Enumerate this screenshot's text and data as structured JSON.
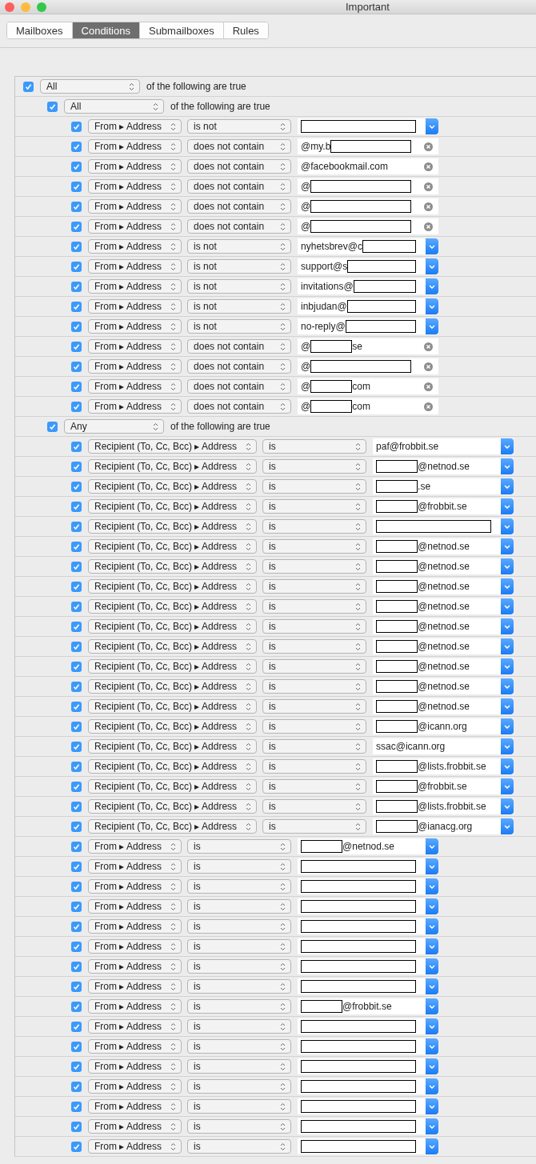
{
  "window": {
    "title": "Important"
  },
  "tabs": [
    {
      "label": "Mailboxes",
      "selected": false
    },
    {
      "label": "Conditions",
      "selected": true
    },
    {
      "label": "Submailboxes",
      "selected": false
    },
    {
      "label": "Rules",
      "selected": false
    }
  ],
  "conditions": {
    "kind": "group",
    "checked": true,
    "match": "All",
    "text": "of the following are true",
    "children": [
      {
        "kind": "group",
        "checked": true,
        "match": "All",
        "text": "of the following are true",
        "children": [
          {
            "kind": "rule",
            "checked": true,
            "field": "From ▸ Address",
            "operator": "is not",
            "value": {
              "kind": "menu",
              "redacted": true
            }
          },
          {
            "kind": "rule",
            "checked": true,
            "field": "From ▸ Address",
            "operator": "does not contain",
            "value": {
              "kind": "clear",
              "before": "@my.b",
              "redacted": true
            }
          },
          {
            "kind": "rule",
            "checked": true,
            "field": "From ▸ Address",
            "operator": "does not contain",
            "value": {
              "kind": "clear",
              "before": "@facebookmail.com"
            }
          },
          {
            "kind": "rule",
            "checked": true,
            "field": "From ▸ Address",
            "operator": "does not contain",
            "value": {
              "kind": "clear",
              "before": "@",
              "redacted": true
            }
          },
          {
            "kind": "rule",
            "checked": true,
            "field": "From ▸ Address",
            "operator": "does not contain",
            "value": {
              "kind": "clear",
              "before": "@",
              "redacted": true
            }
          },
          {
            "kind": "rule",
            "checked": true,
            "field": "From ▸ Address",
            "operator": "does not contain",
            "value": {
              "kind": "clear",
              "before": "@",
              "redacted": true
            }
          },
          {
            "kind": "rule",
            "checked": true,
            "field": "From ▸ Address",
            "operator": "is not",
            "value": {
              "kind": "menu",
              "before": "nyhetsbrev@c",
              "redacted": true
            }
          },
          {
            "kind": "rule",
            "checked": true,
            "field": "From ▸ Address",
            "operator": "is not",
            "value": {
              "kind": "menu",
              "before": "support@s",
              "redacted": true
            }
          },
          {
            "kind": "rule",
            "checked": true,
            "field": "From ▸ Address",
            "operator": "is not",
            "value": {
              "kind": "menu",
              "before": "invitations@",
              "redacted": true
            }
          },
          {
            "kind": "rule",
            "checked": true,
            "field": "From ▸ Address",
            "operator": "is not",
            "value": {
              "kind": "menu",
              "before": "inbjudan@",
              "redacted": true
            }
          },
          {
            "kind": "rule",
            "checked": true,
            "field": "From ▸ Address",
            "operator": "is not",
            "value": {
              "kind": "menu",
              "before": "no-reply@",
              "redacted": true
            }
          },
          {
            "kind": "rule",
            "checked": true,
            "field": "From ▸ Address",
            "operator": "does not contain",
            "value": {
              "kind": "clear",
              "before": "@",
              "redacted": true,
              "after": "se"
            }
          },
          {
            "kind": "rule",
            "checked": true,
            "field": "From ▸ Address",
            "operator": "does not contain",
            "value": {
              "kind": "clear",
              "before": "@",
              "redacted": true
            }
          },
          {
            "kind": "rule",
            "checked": true,
            "field": "From ▸ Address",
            "operator": "does not contain",
            "value": {
              "kind": "clear",
              "before": "@",
              "redacted": true,
              "after": "com"
            }
          },
          {
            "kind": "rule",
            "checked": true,
            "field": "From ▸ Address",
            "operator": "does not contain",
            "value": {
              "kind": "clear",
              "before": "@",
              "redacted": true,
              "after": "com"
            }
          }
        ]
      },
      {
        "kind": "group",
        "checked": true,
        "match": "Any",
        "text": "of the following are true",
        "children": [
          {
            "kind": "rule",
            "checked": true,
            "field": "Recipient (To, Cc, Bcc) ▸ Address",
            "operator": "is",
            "value": {
              "kind": "menu",
              "before": "paf@frobbit.se"
            }
          },
          {
            "kind": "rule",
            "checked": true,
            "field": "Recipient (To, Cc, Bcc) ▸ Address",
            "operator": "is",
            "value": {
              "kind": "menu",
              "redacted": true,
              "after": "@netnod.se"
            }
          },
          {
            "kind": "rule",
            "checked": true,
            "field": "Recipient (To, Cc, Bcc) ▸ Address",
            "operator": "is",
            "value": {
              "kind": "menu",
              "redacted": true,
              "after": ".se"
            }
          },
          {
            "kind": "rule",
            "checked": true,
            "field": "Recipient (To, Cc, Bcc) ▸ Address",
            "operator": "is",
            "value": {
              "kind": "menu",
              "redacted": true,
              "after": "@frobbit.se"
            }
          },
          {
            "kind": "rule",
            "checked": true,
            "field": "Recipient (To, Cc, Bcc) ▸ Address",
            "operator": "is",
            "value": {
              "kind": "menu",
              "redacted": true
            }
          },
          {
            "kind": "rule",
            "checked": true,
            "field": "Recipient (To, Cc, Bcc) ▸ Address",
            "operator": "is",
            "value": {
              "kind": "menu",
              "redacted": true,
              "after": "@netnod.se"
            }
          },
          {
            "kind": "rule",
            "checked": true,
            "field": "Recipient (To, Cc, Bcc) ▸ Address",
            "operator": "is",
            "value": {
              "kind": "menu",
              "redacted": true,
              "after": "@netnod.se"
            }
          },
          {
            "kind": "rule",
            "checked": true,
            "field": "Recipient (To, Cc, Bcc) ▸ Address",
            "operator": "is",
            "value": {
              "kind": "menu",
              "redacted": true,
              "after": "@netnod.se"
            }
          },
          {
            "kind": "rule",
            "checked": true,
            "field": "Recipient (To, Cc, Bcc) ▸ Address",
            "operator": "is",
            "value": {
              "kind": "menu",
              "redacted": true,
              "after": "@netnod.se"
            }
          },
          {
            "kind": "rule",
            "checked": true,
            "field": "Recipient (To, Cc, Bcc) ▸ Address",
            "operator": "is",
            "value": {
              "kind": "menu",
              "redacted": true,
              "after": "@netnod.se"
            }
          },
          {
            "kind": "rule",
            "checked": true,
            "field": "Recipient (To, Cc, Bcc) ▸ Address",
            "operator": "is",
            "value": {
              "kind": "menu",
              "redacted": true,
              "after": "@netnod.se"
            }
          },
          {
            "kind": "rule",
            "checked": true,
            "field": "Recipient (To, Cc, Bcc) ▸ Address",
            "operator": "is",
            "value": {
              "kind": "menu",
              "redacted": true,
              "after": "@netnod.se"
            }
          },
          {
            "kind": "rule",
            "checked": true,
            "field": "Recipient (To, Cc, Bcc) ▸ Address",
            "operator": "is",
            "value": {
              "kind": "menu",
              "redacted": true,
              "after": "@netnod.se"
            }
          },
          {
            "kind": "rule",
            "checked": true,
            "field": "Recipient (To, Cc, Bcc) ▸ Address",
            "operator": "is",
            "value": {
              "kind": "menu",
              "redacted": true,
              "after": "@netnod.se"
            }
          },
          {
            "kind": "rule",
            "checked": true,
            "field": "Recipient (To, Cc, Bcc) ▸ Address",
            "operator": "is",
            "value": {
              "kind": "menu",
              "redacted": true,
              "after": "@icann.org"
            }
          },
          {
            "kind": "rule",
            "checked": true,
            "field": "Recipient (To, Cc, Bcc) ▸ Address",
            "operator": "is",
            "value": {
              "kind": "menu",
              "before": "ssac@icann.org"
            }
          },
          {
            "kind": "rule",
            "checked": true,
            "field": "Recipient (To, Cc, Bcc) ▸ Address",
            "operator": "is",
            "value": {
              "kind": "menu",
              "redacted": true,
              "after": "@lists.frobbit.se"
            }
          },
          {
            "kind": "rule",
            "checked": true,
            "field": "Recipient (To, Cc, Bcc) ▸ Address",
            "operator": "is",
            "value": {
              "kind": "menu",
              "redacted": true,
              "after": "@frobbit.se"
            }
          },
          {
            "kind": "rule",
            "checked": true,
            "field": "Recipient (To, Cc, Bcc) ▸ Address",
            "operator": "is",
            "value": {
              "kind": "menu",
              "redacted": true,
              "after": "@lists.frobbit.se"
            }
          },
          {
            "kind": "rule",
            "checked": true,
            "field": "Recipient (To, Cc, Bcc) ▸ Address",
            "operator": "is",
            "value": {
              "kind": "menu",
              "redacted": true,
              "after": "@ianacg.org"
            }
          },
          {
            "kind": "rule",
            "checked": true,
            "field": "From ▸ Address",
            "operator": "is",
            "value": {
              "kind": "menu",
              "redacted": true,
              "after": "@netnod.se"
            }
          },
          {
            "kind": "rule",
            "checked": true,
            "field": "From ▸ Address",
            "operator": "is",
            "value": {
              "kind": "menu",
              "redacted": true
            }
          },
          {
            "kind": "rule",
            "checked": true,
            "field": "From ▸ Address",
            "operator": "is",
            "value": {
              "kind": "menu",
              "redacted": true
            }
          },
          {
            "kind": "rule",
            "checked": true,
            "field": "From ▸ Address",
            "operator": "is",
            "value": {
              "kind": "menu",
              "redacted": true
            }
          },
          {
            "kind": "rule",
            "checked": true,
            "field": "From ▸ Address",
            "operator": "is",
            "value": {
              "kind": "menu",
              "redacted": true
            }
          },
          {
            "kind": "rule",
            "checked": true,
            "field": "From ▸ Address",
            "operator": "is",
            "value": {
              "kind": "menu",
              "redacted": true
            }
          },
          {
            "kind": "rule",
            "checked": true,
            "field": "From ▸ Address",
            "operator": "is",
            "value": {
              "kind": "menu",
              "redacted": true
            }
          },
          {
            "kind": "rule",
            "checked": true,
            "field": "From ▸ Address",
            "operator": "is",
            "value": {
              "kind": "menu",
              "redacted": true
            }
          },
          {
            "kind": "rule",
            "checked": true,
            "field": "From ▸ Address",
            "operator": "is",
            "value": {
              "kind": "menu",
              "redacted": true,
              "after": "@frobbit.se"
            }
          },
          {
            "kind": "rule",
            "checked": true,
            "field": "From ▸ Address",
            "operator": "is",
            "value": {
              "kind": "menu",
              "redacted": true
            }
          },
          {
            "kind": "rule",
            "checked": true,
            "field": "From ▸ Address",
            "operator": "is",
            "value": {
              "kind": "menu",
              "redacted": true
            }
          },
          {
            "kind": "rule",
            "checked": true,
            "field": "From ▸ Address",
            "operator": "is",
            "value": {
              "kind": "menu",
              "redacted": true
            }
          },
          {
            "kind": "rule",
            "checked": true,
            "field": "From ▸ Address",
            "operator": "is",
            "value": {
              "kind": "menu",
              "redacted": true
            }
          },
          {
            "kind": "rule",
            "checked": true,
            "field": "From ▸ Address",
            "operator": "is",
            "value": {
              "kind": "menu",
              "redacted": true
            }
          },
          {
            "kind": "rule",
            "checked": true,
            "field": "From ▸ Address",
            "operator": "is",
            "value": {
              "kind": "menu",
              "redacted": true
            }
          },
          {
            "kind": "rule",
            "checked": true,
            "field": "From ▸ Address",
            "operator": "is",
            "value": {
              "kind": "menu",
              "redacted": true
            }
          }
        ]
      }
    ]
  }
}
